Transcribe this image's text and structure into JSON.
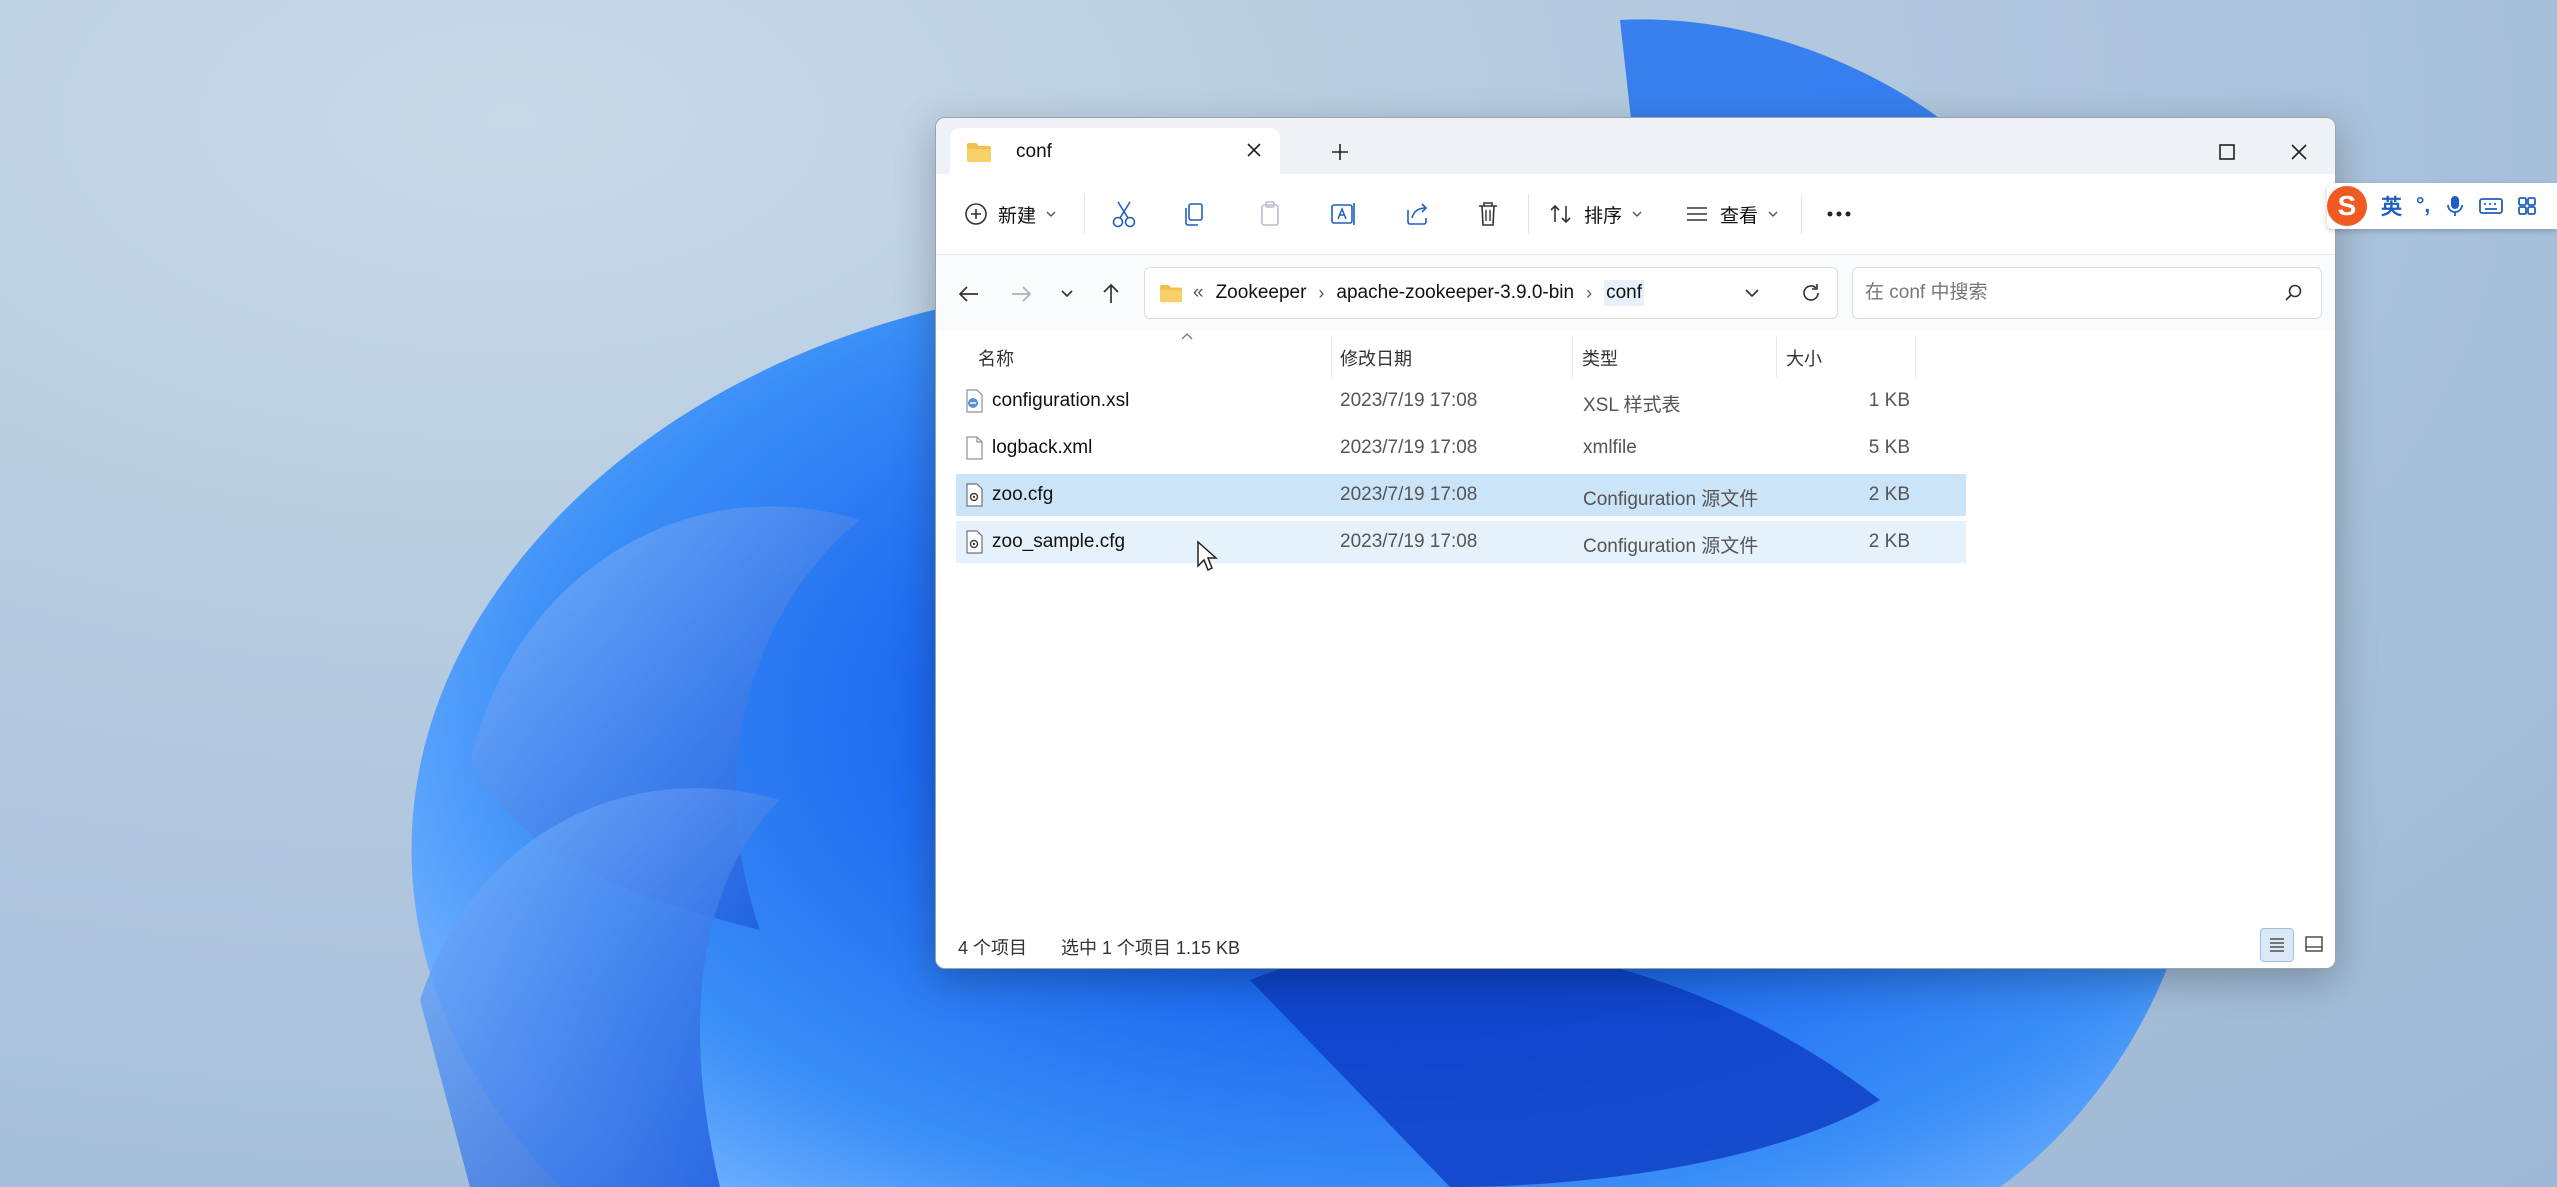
{
  "window": {
    "tab_title": "conf",
    "new_tab_label": "+"
  },
  "toolbar": {
    "new_label": "新建",
    "sort_label": "排序",
    "view_label": "查看",
    "more_label": "..."
  },
  "address": {
    "overflow": "«",
    "crumbs": [
      "Zookeeper",
      "apache-zookeeper-3.9.0-bin",
      "conf"
    ],
    "separator": "›"
  },
  "search": {
    "placeholder": "在 conf 中搜索"
  },
  "columns": {
    "name": "名称",
    "date": "修改日期",
    "type": "类型",
    "size": "大小"
  },
  "files": [
    {
      "name": "configuration.xsl",
      "date": "2023/7/19 17:08",
      "type": "XSL 样式表",
      "size": "1 KB",
      "icon": "xsl-file-icon"
    },
    {
      "name": "logback.xml",
      "date": "2023/7/19 17:08",
      "type": "xmlfile",
      "size": "5 KB",
      "icon": "document-icon"
    },
    {
      "name": "zoo.cfg",
      "date": "2023/7/19 17:08",
      "type": "Configuration 源文件",
      "size": "2 KB",
      "icon": "config-file-icon",
      "state": "selected"
    },
    {
      "name": "zoo_sample.cfg",
      "date": "2023/7/19 17:08",
      "type": "Configuration 源文件",
      "size": "2 KB",
      "icon": "config-file-icon",
      "state": "hover"
    }
  ],
  "status": {
    "count": "4 个项目",
    "selection": "选中 1 个项目  1.15 KB"
  },
  "ime": {
    "logo": "S",
    "lang": "英",
    "punct": "°,"
  },
  "colors": {
    "selected_row": "#cce4f7",
    "hover_row": "#e5f1fb",
    "accent": "#0067c0",
    "folder": "#f3c04b"
  }
}
